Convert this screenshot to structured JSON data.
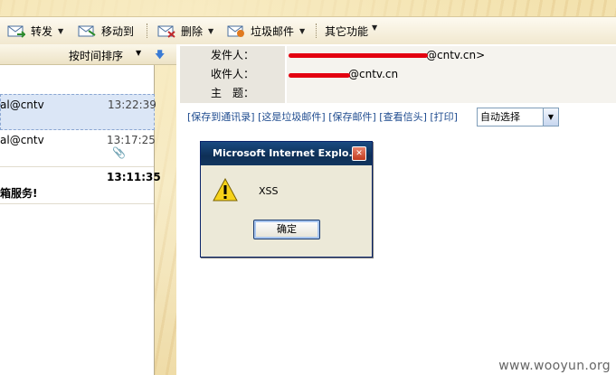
{
  "toolbar": {
    "forward": "转发",
    "move": "移动到",
    "delete": "删除",
    "spam": "垃圾邮件",
    "other": "其它功能"
  },
  "mail_list": {
    "sort_label": "按时间排序",
    "items": [
      {
        "sender": "al@cntv",
        "time": "13:22:39",
        "selected": true
      },
      {
        "sender": "al@cntv",
        "time": "13:17:25",
        "attachment": true
      },
      {
        "sender": "箱服务!",
        "time": "13:11:35",
        "bold": true
      }
    ]
  },
  "headers": {
    "from_label": "发件人：",
    "from_value": "@cntv.cn>",
    "to_label": "收件人：",
    "to_value": "@cntv.cn",
    "subject_label": "主　题：",
    "subject_value": ""
  },
  "actions": {
    "save_contact": "[保存到通讯录]",
    "is_spam": "[这是垃圾邮件]",
    "save_mail": "[保存邮件]",
    "view_header": "[查看信头]",
    "print": "[打印]"
  },
  "encoding_select": {
    "value": "自动选择"
  },
  "dialog": {
    "title": "Microsoft Internet Explo...",
    "message": "XSS",
    "ok": "确定"
  },
  "watermark": "www.wooyun.org"
}
